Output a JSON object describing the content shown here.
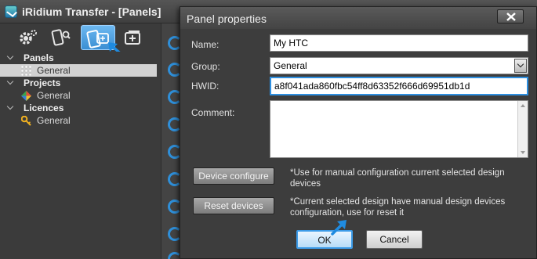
{
  "window": {
    "title": "iRidium Transfer - [Panels]"
  },
  "toolbar": {
    "buttons": [
      {
        "icon": "gear-icon"
      },
      {
        "icon": "device-search-icon"
      },
      {
        "icon": "panels-icon",
        "active": true
      },
      {
        "icon": "add-device-icon"
      }
    ]
  },
  "tree": {
    "panels": {
      "label": "Panels",
      "items": [
        {
          "label": "General",
          "icon": "grid-icon",
          "selected": true
        }
      ]
    },
    "projects": {
      "label": "Projects",
      "items": [
        {
          "label": "General",
          "icon": "project-icon"
        }
      ]
    },
    "licences": {
      "label": "Licences",
      "items": [
        {
          "label": "General",
          "icon": "key-icon"
        }
      ]
    }
  },
  "dialog": {
    "title": "Panel properties",
    "name_label": "Name:",
    "name_value": "My HTC",
    "group_label": "Group:",
    "group_value": "General",
    "hwid_label": "HWID:",
    "hwid_value": "a8f041ada860fbc54ff8d63352f666d69951db1d",
    "comment_label": "Comment:",
    "comment_value": "",
    "device_configure_label": "Device configure",
    "device_configure_note": "*Use for manual configuration current selected design devices",
    "reset_devices_label": "Reset devices",
    "reset_devices_note": "*Current selected design have manual design devices configuration, use for reset it",
    "ok_label": "OK",
    "cancel_label": "Cancel"
  },
  "colors": {
    "accent": "#2e8fe0",
    "window_bg": "#3b3b3b",
    "selected_item": "#d2d2d2"
  }
}
